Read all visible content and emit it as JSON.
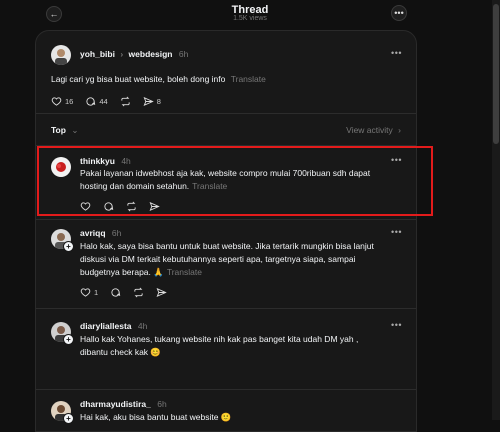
{
  "header": {
    "title": "Thread",
    "views": "1.5K views",
    "back_icon": "arrow-left-icon",
    "more_icon": "more-icon"
  },
  "main_post": {
    "author": "yoh_bibi",
    "channel": "webdesign",
    "time": "6h",
    "text": "Lagi cari yg bisa buat website, boleh dong info",
    "translate": "Translate",
    "likes": "16",
    "replies": "44",
    "shares": "8"
  },
  "sort": {
    "label": "Top",
    "view_activity": "View activity"
  },
  "replies": [
    {
      "author": "thinkkyu",
      "time": "4h",
      "text_lines": [
        "Pakai layanan idwebhost aja kak, website compro mulai 700ribuan sdh dapat",
        "hosting dan domain setahun."
      ],
      "translate": "Translate",
      "likes": ""
    },
    {
      "author": "avriqq",
      "time": "6h",
      "text_lines": [
        "Halo kak, saya bisa bantu untuk buat website. Jika tertarik mungkin bisa lanjut",
        "diskusi via DM terkait kebutuhannya seperti apa, targetnya siapa, sampai",
        "budgetnya berapa. 🙏"
      ],
      "translate": "Translate",
      "likes": "1"
    },
    {
      "author": "diaryliallesta",
      "time": "4h",
      "text_lines": [
        "Hallo kak Yohanes, tukang website nih kak pas banget kita udah DM yah ,",
        "dibantu check kak 😊"
      ],
      "translate": "",
      "likes": ""
    },
    {
      "author": "dharmayudistira_",
      "time": "6h",
      "text_lines": [
        "Hai kak, aku bisa bantu buat website 🙂"
      ],
      "translate": "",
      "likes": ""
    }
  ],
  "colors": {
    "background": "#101010",
    "panel": "#181818",
    "highlight": "#e31b1b",
    "muted": "#777777"
  }
}
